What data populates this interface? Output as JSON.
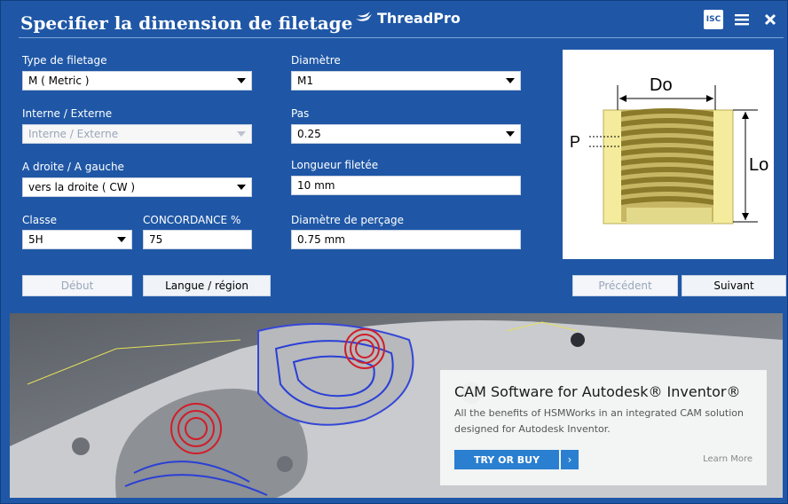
{
  "header": {
    "title": "Specifier la dimension de filetage",
    "brand": "ThreadPro",
    "badge_text": "ISC",
    "menu_icon": "hamburger-icon",
    "close_icon": "close-icon"
  },
  "form": {
    "thread_type": {
      "label": "Type de filetage",
      "value": "M ( Metric )"
    },
    "internal_external": {
      "label": "Interne / Externe",
      "value": "Interne / Externe"
    },
    "hand": {
      "label": "A droite / A gauche",
      "value": "vers la droite ( CW )"
    },
    "class": {
      "label": "Classe",
      "value": "5H"
    },
    "concordance": {
      "label": "CONCORDANCE %",
      "value": "75"
    },
    "diameter": {
      "label": "Diamètre",
      "value": "M1"
    },
    "pitch": {
      "label": "Pas",
      "value": "0.25"
    },
    "thread_length": {
      "label": "Longueur filetée",
      "value": "10 mm"
    },
    "drill_diameter": {
      "label": "Diamètre de perçage",
      "value": "0.75 mm"
    }
  },
  "buttons": {
    "start": "Début",
    "language": "Langue / région",
    "previous": "Précédent",
    "next": "Suivant"
  },
  "diagram": {
    "do_label": "Do",
    "p_label": "P",
    "lo_label": "Lo"
  },
  "banner": {
    "title": "CAM Software for Autodesk® Inventor®",
    "subtitle": "All the benefits of HSMWorks in an integrated CAM solution designed for Autodesk Inventor.",
    "try_button": "TRY OR BUY",
    "try_arrow": "›",
    "learn_more": "Learn More"
  },
  "colors": {
    "background": "#1f57a6",
    "accent": "#2a7fd0",
    "thread_fill": "#f4ec9c",
    "thread_teeth": "#8b7a2a"
  }
}
